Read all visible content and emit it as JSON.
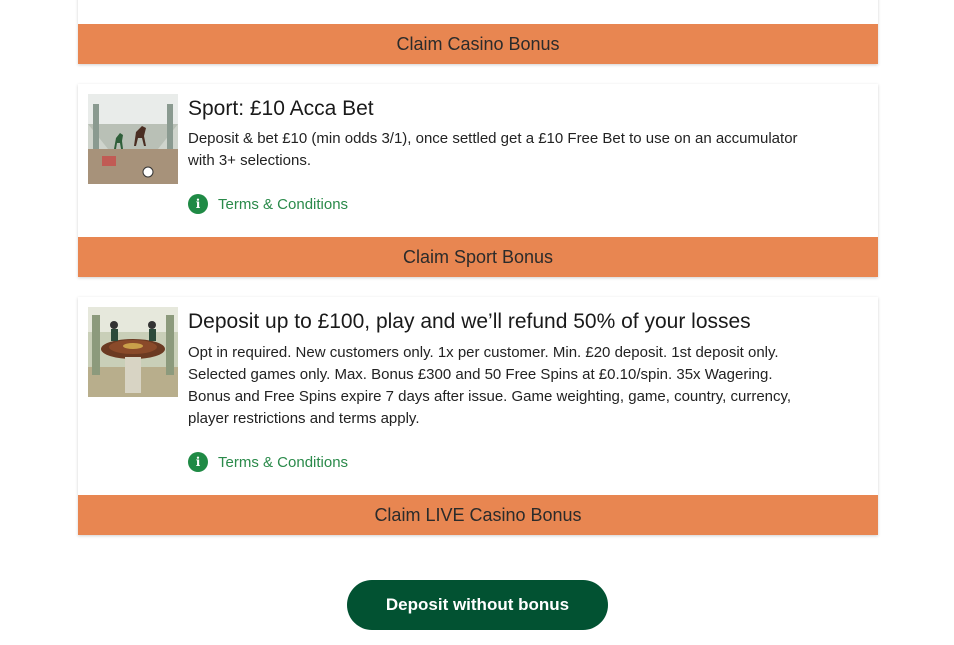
{
  "offers": [
    {
      "claim_label": "Claim Casino Bonus"
    },
    {
      "title": "Sport: £10 Acca Bet",
      "description": "Deposit & bet £10 (min odds 3/1), once settled get a £10 Free Bet to use on an accumulator with 3+ selections.",
      "terms_label": "Terms & Conditions",
      "claim_label": "Claim Sport Bonus",
      "image": "sport-horse-racing-image"
    },
    {
      "title": "Deposit up to £100, play and we’ll refund 50% of your losses",
      "description": "Opt in required. New customers only. 1x per customer. Min. £20 deposit. 1st deposit only. Selected games only. Max. Bonus £300 and 50 Free Spins at £0.10/spin. 35x Wagering. Bonus and Free Spins expire 7 days after issue. Game weighting, game, country, currency, player restrictions and terms apply.",
      "terms_label": "Terms & Conditions",
      "claim_label": "Claim LIVE Casino Bonus",
      "image": "live-roulette-image"
    }
  ],
  "deposit_without_bonus_label": "Deposit without bonus",
  "colors": {
    "claim_button": "#e88651",
    "deposit_button": "#025232",
    "terms_link": "#2a8a4a"
  },
  "icons": {
    "info": "i"
  }
}
